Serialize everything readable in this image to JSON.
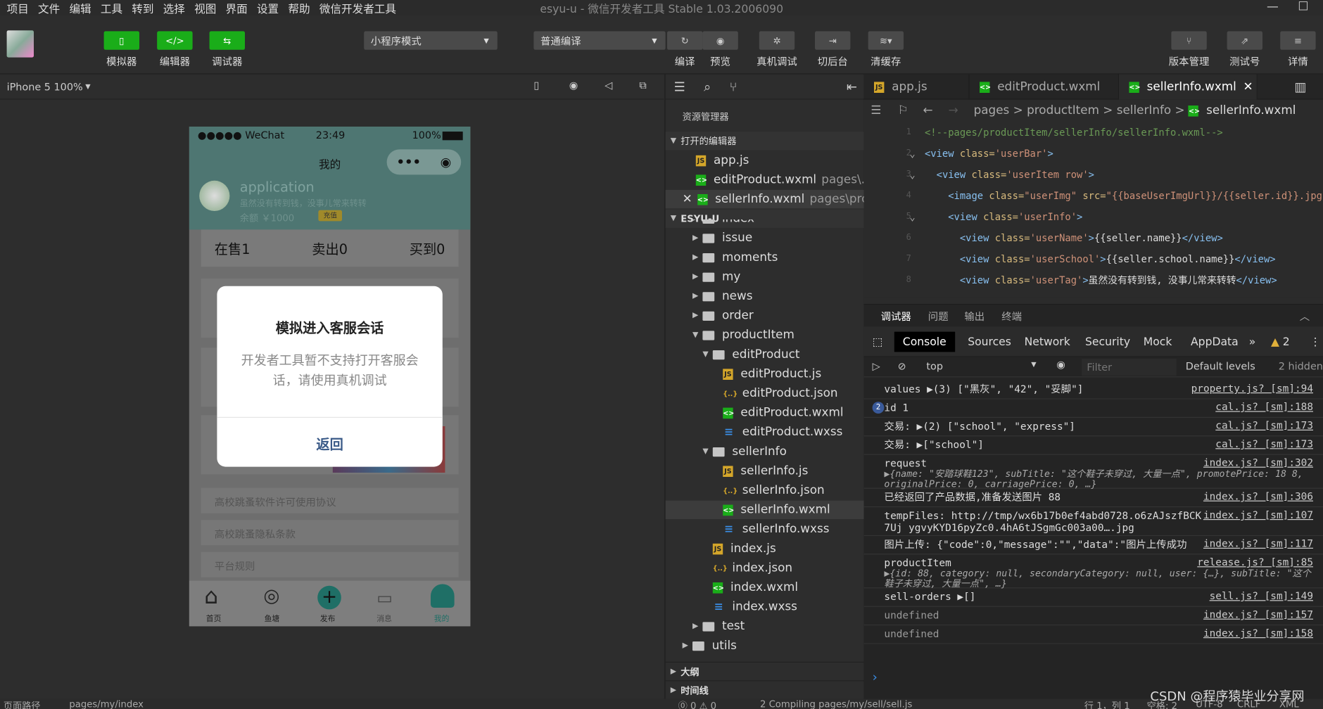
{
  "menu": [
    "项目",
    "文件",
    "编辑",
    "工具",
    "转到",
    "选择",
    "视图",
    "界面",
    "设置",
    "帮助",
    "微信开发者工具"
  ],
  "window_title": "esyu-u - 微信开发者工具 Stable 1.03.2006090",
  "toolbar": {
    "simulator": "模拟器",
    "editor": "编辑器",
    "debugger": "调试器",
    "mode": "小程序模式",
    "compile_mode": "普通编译",
    "compile": "编译",
    "preview": "预览",
    "real_debug": "真机调试",
    "background": "切后台",
    "clear_cache": "清缓存",
    "version": "版本管理",
    "test_account": "测试号",
    "details": "详情"
  },
  "simulator": {
    "device": "iPhone 5 100%",
    "status_carrier": "●●●●● WeChat",
    "status_time": "23:49",
    "status_battery": "100%",
    "nav_title": "我的",
    "user_name": "application",
    "user_tag": "虽然没有转到钱，没事儿常来转转",
    "balance": "余额 ￥1000",
    "recharge": "充值",
    "stats": [
      "在售1",
      "卖出0",
      "买到0"
    ],
    "menu_items": [
      "高校跳蚤软件许可使用协议",
      "高校跳蚤隐私条款",
      "平台规则"
    ],
    "tabbar": [
      "首页",
      "鱼塘",
      "发布",
      "消息",
      "我的"
    ],
    "modal": {
      "title": "模拟进入客服会话",
      "content": "开发者工具暂不支持打开客服会话，请使用真机调试",
      "button": "返回"
    }
  },
  "explorer": {
    "title": "资源管理器",
    "open_editors": "打开的编辑器",
    "open_files": [
      {
        "name": "app.js",
        "path": "",
        "type": "js"
      },
      {
        "name": "editProduct.wxml",
        "path": "pages\\...",
        "type": "wxml"
      },
      {
        "name": "sellerInfo.wxml",
        "path": "pages\\pro...",
        "type": "wxml"
      }
    ],
    "project": "ESYU-U",
    "tree": [
      {
        "name": "index",
        "type": "dir",
        "indent": 1
      },
      {
        "name": "issue",
        "type": "dir",
        "indent": 1
      },
      {
        "name": "moments",
        "type": "dir",
        "indent": 1
      },
      {
        "name": "my",
        "type": "dir",
        "indent": 1
      },
      {
        "name": "news",
        "type": "dir",
        "indent": 1
      },
      {
        "name": "order",
        "type": "dir",
        "indent": 1
      },
      {
        "name": "productItem",
        "type": "dir-open",
        "indent": 1
      },
      {
        "name": "editProduct",
        "type": "dir-open",
        "indent": 2
      },
      {
        "name": "editProduct.js",
        "type": "js",
        "indent": 3
      },
      {
        "name": "editProduct.json",
        "type": "json",
        "indent": 3
      },
      {
        "name": "editProduct.wxml",
        "type": "wxml",
        "indent": 3
      },
      {
        "name": "editProduct.wxss",
        "type": "wxss",
        "indent": 3
      },
      {
        "name": "sellerInfo",
        "type": "dir-open",
        "indent": 2
      },
      {
        "name": "sellerInfo.js",
        "type": "js",
        "indent": 3
      },
      {
        "name": "sellerInfo.json",
        "type": "json",
        "indent": 3
      },
      {
        "name": "sellerInfo.wxml",
        "type": "wxml",
        "indent": 3
      },
      {
        "name": "sellerInfo.wxss",
        "type": "wxss",
        "indent": 3
      },
      {
        "name": "index.js",
        "type": "js",
        "indent": 2
      },
      {
        "name": "index.json",
        "type": "json",
        "indent": 2
      },
      {
        "name": "index.wxml",
        "type": "wxml",
        "indent": 2
      },
      {
        "name": "index.wxss",
        "type": "wxss",
        "indent": 2
      },
      {
        "name": "test",
        "type": "dir",
        "indent": 1
      },
      {
        "name": "utils",
        "type": "dir",
        "indent": 0
      }
    ],
    "outline": "大纲",
    "timeline": "时间线"
  },
  "editor": {
    "tabs": [
      "app.js",
      "editProduct.wxml",
      "sellerInfo.wxml"
    ],
    "breadcrumb": [
      "pages",
      "productItem",
      "sellerInfo",
      "sellerInfo.wxml"
    ],
    "lines": [
      "<!--pages/productItem/sellerInfo/sellerInfo.wxml-->",
      "<view class='userBar'>",
      "  <view class='userItem row'>",
      "    <image class=\"userImg\" src=\"{{baseUserImgUrl}}/{{seller.id}}.jpg\"",
      "    <view class='userInfo'>",
      "      <view class='userName'>{{seller.name}}</view>",
      "      <view class='userSchool'>{{seller.school.name}}</view>",
      "      <view class='userTag'>虽然没有转到钱, 没事儿常来转转</view>"
    ]
  },
  "debugger": {
    "tabs": [
      "调试器",
      "问题",
      "输出",
      "终端"
    ],
    "console_tabs": [
      "Console",
      "Sources",
      "Network",
      "Security",
      "Mock",
      "AppData"
    ],
    "warnings": "2",
    "context": "top",
    "filter_placeholder": "Filter",
    "levels": "Default levels",
    "hidden": "2 hidden",
    "logs": [
      {
        "text": "values ▶(3) [\"黑灰\", \"42\", \"妥脚\"]",
        "src": "property.js? [sm]:94"
      },
      {
        "text": "id 1",
        "src": "cal.js? [sm]:188",
        "count": "2"
      },
      {
        "text": "交易: ▶(2) [\"school\", \"express\"]",
        "src": "cal.js? [sm]:173"
      },
      {
        "text": "交易: ▶[\"school\"]",
        "src": "cal.js? [sm]:173"
      },
      {
        "text": "request",
        "sub": "▶{name: \"安踏球鞋123\", subTitle: \"这个鞋子未穿过, 大量一点\", promotePrice: 18 8, originalPrice: 0, carriagePrice: 0, …}",
        "src": "index.js? [sm]:302"
      },
      {
        "text": "已经返回了产品数据,准备发送图片 88",
        "src": "index.js? [sm]:306"
      },
      {
        "text": "tempFiles: http://tmp/wx6b17b0ef4abd0728.o6zAJszfBCK7Uj ygvyKYD16pyZc0.4hA6tJSgmGc003a00….jpg",
        "src": "index.js? [sm]:107"
      },
      {
        "text": "图片上传: {\"code\":0,\"message\":\"\",\"data\":\"图片上传成功\"}",
        "src": "index.js? [sm]:117"
      },
      {
        "text": "productItem",
        "sub": "▶{id: 88, category: null, secondaryCategory: null, user: {…}, subTitle: \"这个鞋子未穿过, 大量一点\", …}",
        "src": "release.js? [sm]:85"
      },
      {
        "text": "sell-orders ▶[]",
        "src": "sell.js? [sm]:149"
      },
      {
        "text": "undefined",
        "src": "index.js? [sm]:157"
      },
      {
        "text": "undefined",
        "src": "index.js? [sm]:158"
      }
    ]
  },
  "status": {
    "path_label": "页面路径",
    "path": "pages/my/index",
    "errors": "⓪ 0 ⚠ 0",
    "compiling": "2 Compiling pages/my/sell/sell.js",
    "cursor": "行 1，列 1",
    "spaces": "空格: 2",
    "encoding": "UTF-8",
    "eol": "CRLF",
    "lang": "XML"
  },
  "watermark": "CSDN @程序猿毕业分享网"
}
